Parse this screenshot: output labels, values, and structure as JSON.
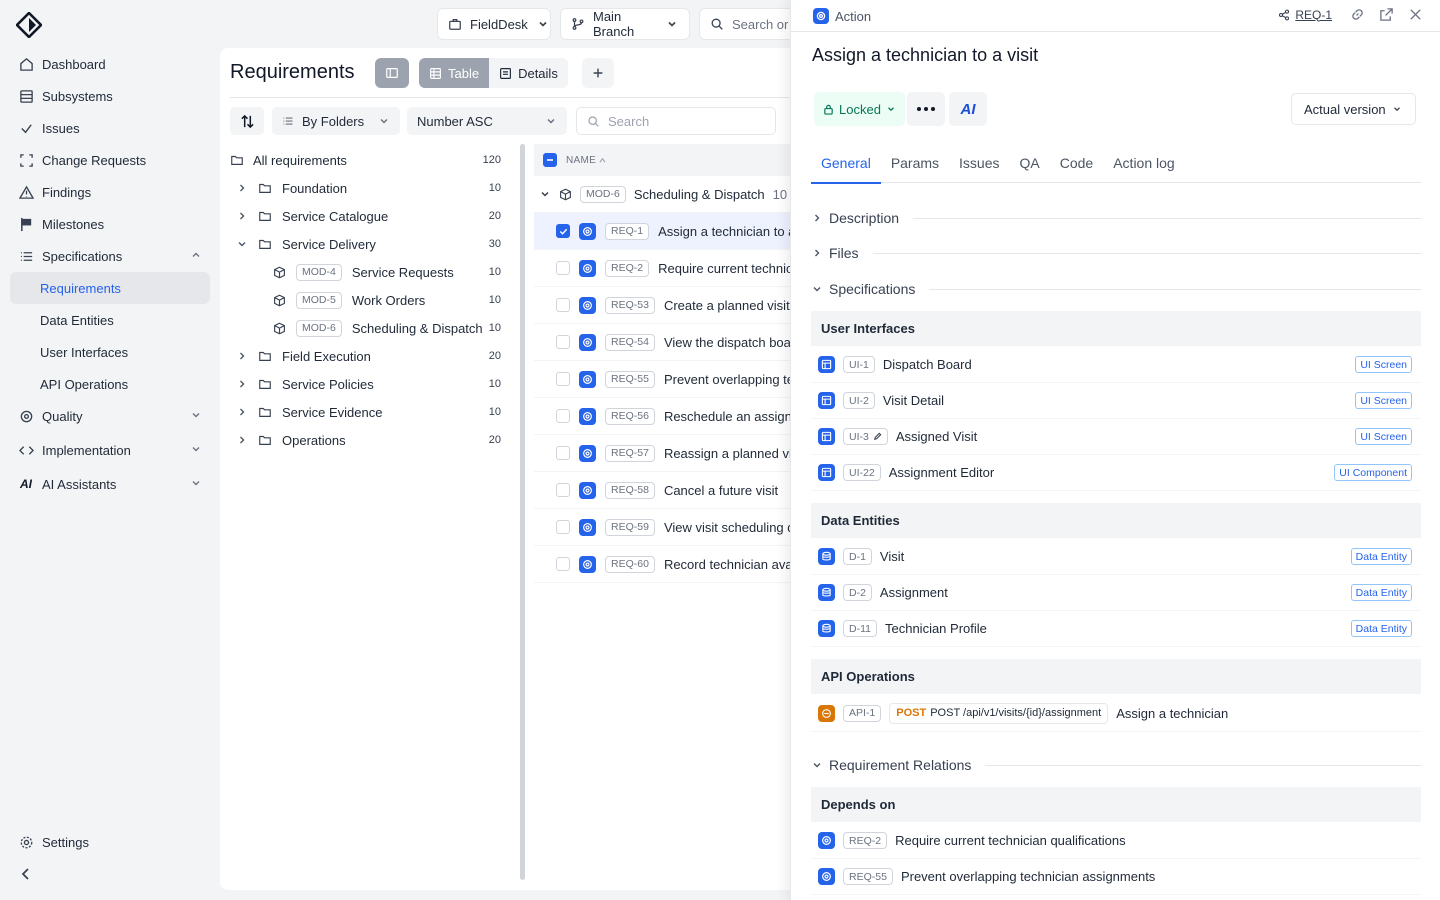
{
  "sidebar": {
    "items": [
      {
        "label": "Dashboard",
        "icon": "dashboard-icon"
      },
      {
        "label": "Subsystems",
        "icon": "subsystems-icon"
      },
      {
        "label": "Issues",
        "icon": "check-icon"
      },
      {
        "label": "Change Requests",
        "icon": "change-requests-icon"
      },
      {
        "label": "Findings",
        "icon": "warning-icon"
      },
      {
        "label": "Milestones",
        "icon": "flag-icon"
      },
      {
        "label": "Specifications",
        "icon": "list-icon"
      }
    ],
    "spec_subitems": [
      "Requirements",
      "Data Entities",
      "User Interfaces",
      "API Operations"
    ],
    "lower_items": [
      {
        "label": "Quality",
        "icon": "quality-icon"
      },
      {
        "label": "Implementation",
        "icon": "code-icon"
      },
      {
        "label": "AI Assistants",
        "icon": "ai-icon"
      }
    ],
    "settings_label": "Settings"
  },
  "topbar": {
    "project": "FieldDesk",
    "branch": "Main Branch",
    "search_placeholder": "Search or"
  },
  "main": {
    "title": "Requirements",
    "view_table": "Table",
    "view_details": "Details",
    "group_by": "By Folders",
    "sort_by": "Number ASC",
    "search_placeholder": "Search",
    "name_header": "NAME"
  },
  "tree": {
    "root": {
      "label": "All requirements",
      "count": "120"
    },
    "folders": [
      {
        "label": "Foundation",
        "count": "10"
      },
      {
        "label": "Service Catalogue",
        "count": "20"
      },
      {
        "label": "Service Delivery",
        "count": "30"
      }
    ],
    "modules": [
      {
        "tag": "MOD-4",
        "label": "Service Requests",
        "count": "10"
      },
      {
        "tag": "MOD-5",
        "label": "Work Orders",
        "count": "10"
      },
      {
        "tag": "MOD-6",
        "label": "Scheduling & Dispatch",
        "count": "10"
      }
    ],
    "folders_after": [
      {
        "label": "Field Execution",
        "count": "20"
      },
      {
        "label": "Service Policies",
        "count": "10"
      },
      {
        "label": "Service Evidence",
        "count": "10"
      },
      {
        "label": "Operations",
        "count": "20"
      }
    ]
  },
  "table": {
    "group": {
      "tag": "MOD-6",
      "label": "Scheduling & Dispatch",
      "count": "10"
    },
    "rows": [
      {
        "id": "REQ-1",
        "name": "Assign a technician to a visit"
      },
      {
        "id": "REQ-2",
        "name": "Require current technician qualifications"
      },
      {
        "id": "REQ-53",
        "name": "Create a planned visit"
      },
      {
        "id": "REQ-54",
        "name": "View the dispatch board"
      },
      {
        "id": "REQ-55",
        "name": "Prevent overlapping technician assignments"
      },
      {
        "id": "REQ-56",
        "name": "Reschedule an assigned visit"
      },
      {
        "id": "REQ-57",
        "name": "Reassign a planned visit"
      },
      {
        "id": "REQ-58",
        "name": "Cancel a future visit"
      },
      {
        "id": "REQ-59",
        "name": "View visit scheduling details"
      },
      {
        "id": "REQ-60",
        "name": "Record technician availability"
      }
    ]
  },
  "panel": {
    "type_label": "Action",
    "ref": "REQ-1",
    "title": "Assign a technician to a visit",
    "lock_label": "Locked",
    "ai_label": "AI",
    "version_label": "Actual version",
    "tabs": [
      "General",
      "Params",
      "Issues",
      "QA",
      "Code",
      "Action log"
    ],
    "sections": {
      "description": "Description",
      "files": "Files",
      "specifications": "Specifications",
      "relations": "Requirement Relations"
    },
    "ui_group": "User Interfaces",
    "ui_items": [
      {
        "tag": "UI-1",
        "name": "Dispatch Board",
        "badge": "UI Screen"
      },
      {
        "tag": "UI-2",
        "name": "Visit Detail",
        "badge": "UI Screen"
      },
      {
        "tag": "UI-3",
        "name": "Assigned Visit",
        "badge": "UI Screen"
      },
      {
        "tag": "UI-22",
        "name": "Assignment Editor",
        "badge": "UI Component"
      }
    ],
    "de_group": "Data Entities",
    "de_items": [
      {
        "tag": "D-1",
        "name": "Visit",
        "badge": "Data Entity"
      },
      {
        "tag": "D-2",
        "name": "Assignment",
        "badge": "Data Entity"
      },
      {
        "tag": "D-11",
        "name": "Technician Profile",
        "badge": "Data Entity"
      }
    ],
    "api_group": "API Operations",
    "api_item": {
      "tag": "API-1",
      "method": "POST",
      "path": "POST /api/v1/visits/{id}/assignment",
      "name": "Assign a technician"
    },
    "depends_group": "Depends on",
    "depends": [
      {
        "tag": "REQ-2",
        "name": "Require current technician qualifications"
      },
      {
        "tag": "REQ-55",
        "name": "Prevent overlapping technician assignments"
      }
    ]
  },
  "colors": {
    "accent": "#2563eb",
    "locked": "#047857",
    "api": "#d97706"
  }
}
